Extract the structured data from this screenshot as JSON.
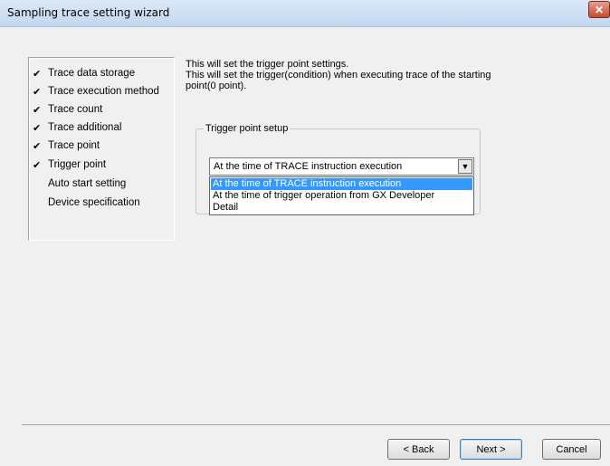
{
  "window": {
    "title": "Sampling trace setting wizard",
    "close_icon": "x-close-icon"
  },
  "steps": [
    {
      "label": "Trace data storage",
      "completed": true
    },
    {
      "label": "Trace execution method",
      "completed": true
    },
    {
      "label": "Trace count",
      "completed": true
    },
    {
      "label": "Trace additional",
      "completed": true
    },
    {
      "label": "Trace point",
      "completed": true
    },
    {
      "label": "Trigger point",
      "completed": true
    },
    {
      "label": "Auto start setting",
      "completed": false
    },
    {
      "label": "Device specification",
      "completed": false
    }
  ],
  "check_glyph": "✔",
  "description": {
    "line1": "This will set the trigger point settings.",
    "line2": "This will set the trigger(condition) when executing trace of the starting",
    "line3": "point(0 point)."
  },
  "trigger_group": {
    "legend": "Trigger point setup",
    "selected_value": "At the time of TRACE instruction execution",
    "options": [
      "At the time of TRACE instruction execution",
      "At the time of trigger operation from GX Developer",
      "Detail"
    ],
    "highlighted_index": 0
  },
  "buttons": {
    "back": "< Back",
    "next": "Next >",
    "cancel": "Cancel"
  }
}
